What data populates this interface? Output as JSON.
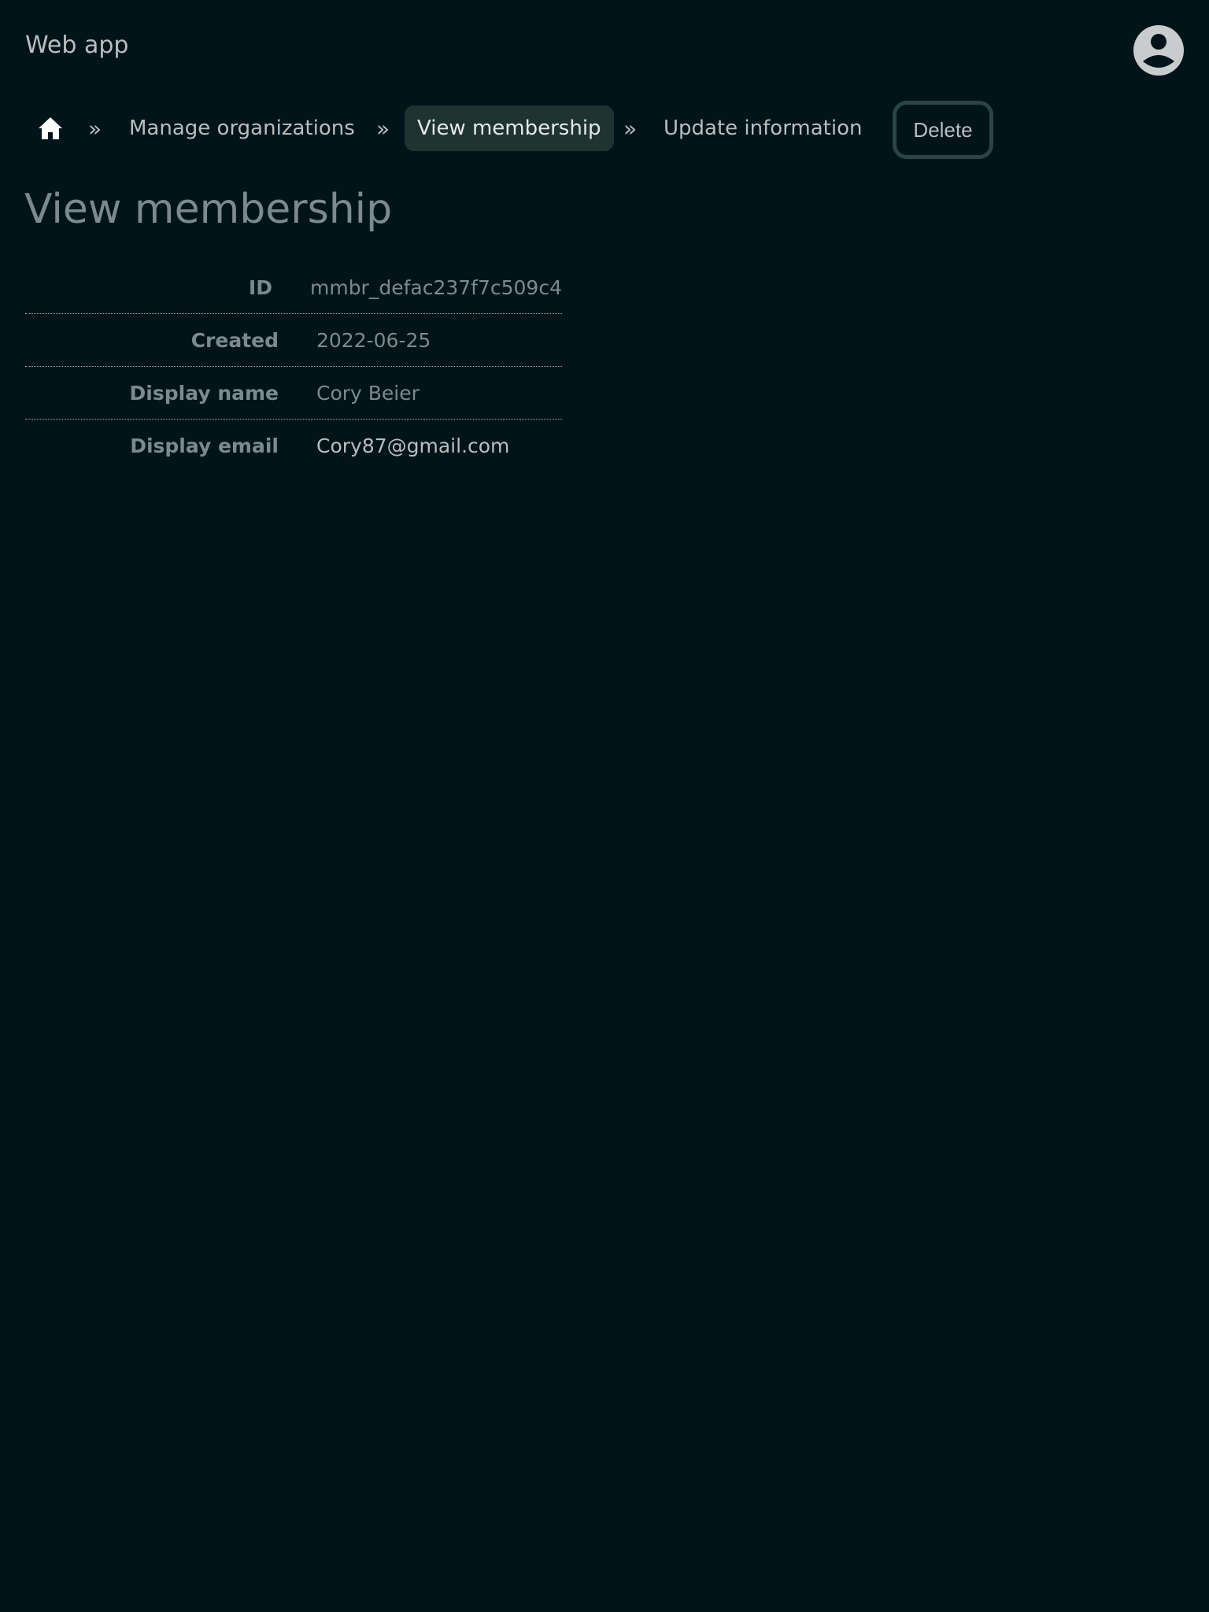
{
  "header": {
    "app_title": "Web app",
    "avatar_icon": "user-circle-icon"
  },
  "breadcrumb": {
    "home_icon": "home-icon",
    "separator": "»",
    "items": [
      {
        "label": "Manage organizations"
      },
      {
        "label": "View membership",
        "active": true
      },
      {
        "label": "Update information"
      }
    ],
    "delete_label": "Delete"
  },
  "main": {
    "title": "View membership",
    "details": [
      {
        "label": "ID",
        "value": "mmbr_defac237f7c509c4"
      },
      {
        "label": "Created",
        "value": "2022-06-25"
      },
      {
        "label": "Display name",
        "value": "Cory Beier"
      },
      {
        "label": "Display email",
        "value": "Cory87@gmail.com"
      }
    ]
  },
  "colors": {
    "background": "#00141a",
    "active_crumb_bg": "#1f3431",
    "delete_border": "#2a4447",
    "text_muted": "#7c8a8d",
    "text_light": "#b9bebe"
  }
}
